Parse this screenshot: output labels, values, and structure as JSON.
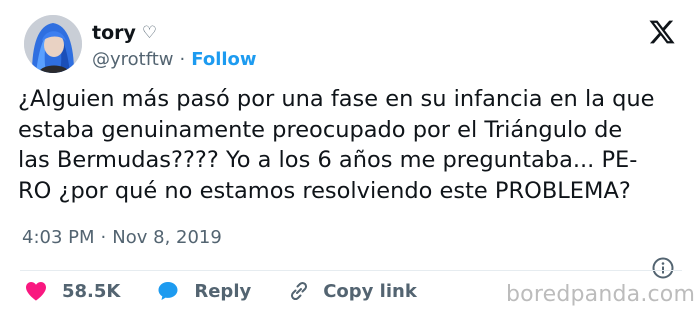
{
  "author": {
    "name": "tory",
    "name_symbol": "♡",
    "handle": "@yrotftw",
    "separator": "·",
    "follow_label": "Follow"
  },
  "platform_logo": "x-logo-icon",
  "tweet_lines": [
    "¿Alguien más pasó por una fase en su infancia en la que",
    "estaba genuinamente preocupado por el Triángulo de",
    "las Bermudas???? Yo a los 6 años me preguntaba... PE-",
    "RO ¿por qué no estamos resolviendo este PROBLEMA?"
  ],
  "meta": {
    "time": "4:03 PM",
    "separator": "·",
    "date": "Nov 8, 2019"
  },
  "actions": {
    "likes_count": "58.5K",
    "reply_label": "Reply",
    "copy_link_label": "Copy link"
  },
  "watermark": "boredpanda.com",
  "colors": {
    "accent": "#1d9bf0",
    "like": "#f91880",
    "muted": "#536471",
    "text": "#0f1419"
  }
}
